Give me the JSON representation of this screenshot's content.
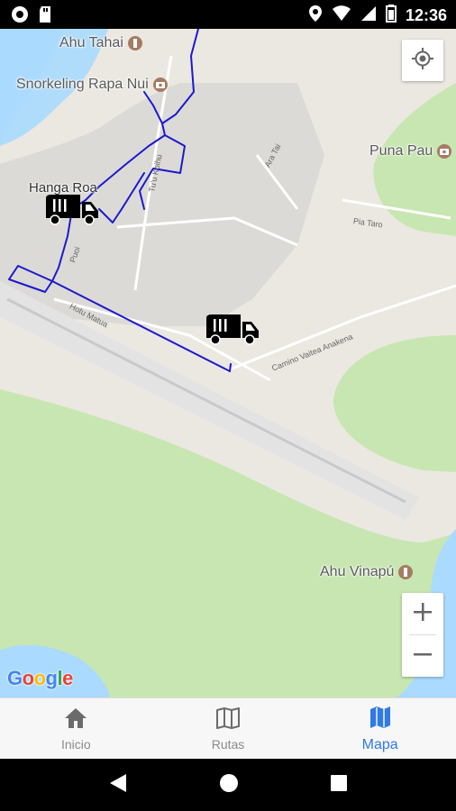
{
  "status_bar": {
    "time": "12:36"
  },
  "map": {
    "pois": [
      {
        "name": "Ahu Tahai",
        "icon": "monument-icon"
      },
      {
        "name": "Snorkeling Rapa Nui",
        "icon": "camera-icon"
      },
      {
        "name": "Puna Pau",
        "icon": "camera-icon"
      },
      {
        "name": "Ahu Vinapú",
        "icon": "monument-icon"
      }
    ],
    "places": [
      "Hanga Roa"
    ],
    "streets": [
      "Tu'u Koihu",
      "Ara Tai",
      "Pia Taro",
      "Puoi",
      "Hotu Matua",
      "Camino Vaitea Anakena"
    ],
    "zoom_in_label": "+",
    "zoom_out_label": "−",
    "google_logo": [
      "G",
      "o",
      "o",
      "g",
      "l",
      "e"
    ],
    "google_colors": [
      "#4285F4",
      "#EA4335",
      "#FBBC05",
      "#4285F4",
      "#34A853",
      "#EA4335"
    ],
    "route_color": "#1a1acc",
    "vehicles": [
      "garbage-truck-icon",
      "garbage-truck-icon"
    ]
  },
  "bottom_nav": {
    "items": [
      {
        "label": "Inicio",
        "icon": "home-icon",
        "active": false
      },
      {
        "label": "Rutas",
        "icon": "map-book-icon",
        "active": false
      },
      {
        "label": "Mapa",
        "icon": "map-icon",
        "active": true
      }
    ],
    "active_color": "#2f7ae5"
  }
}
